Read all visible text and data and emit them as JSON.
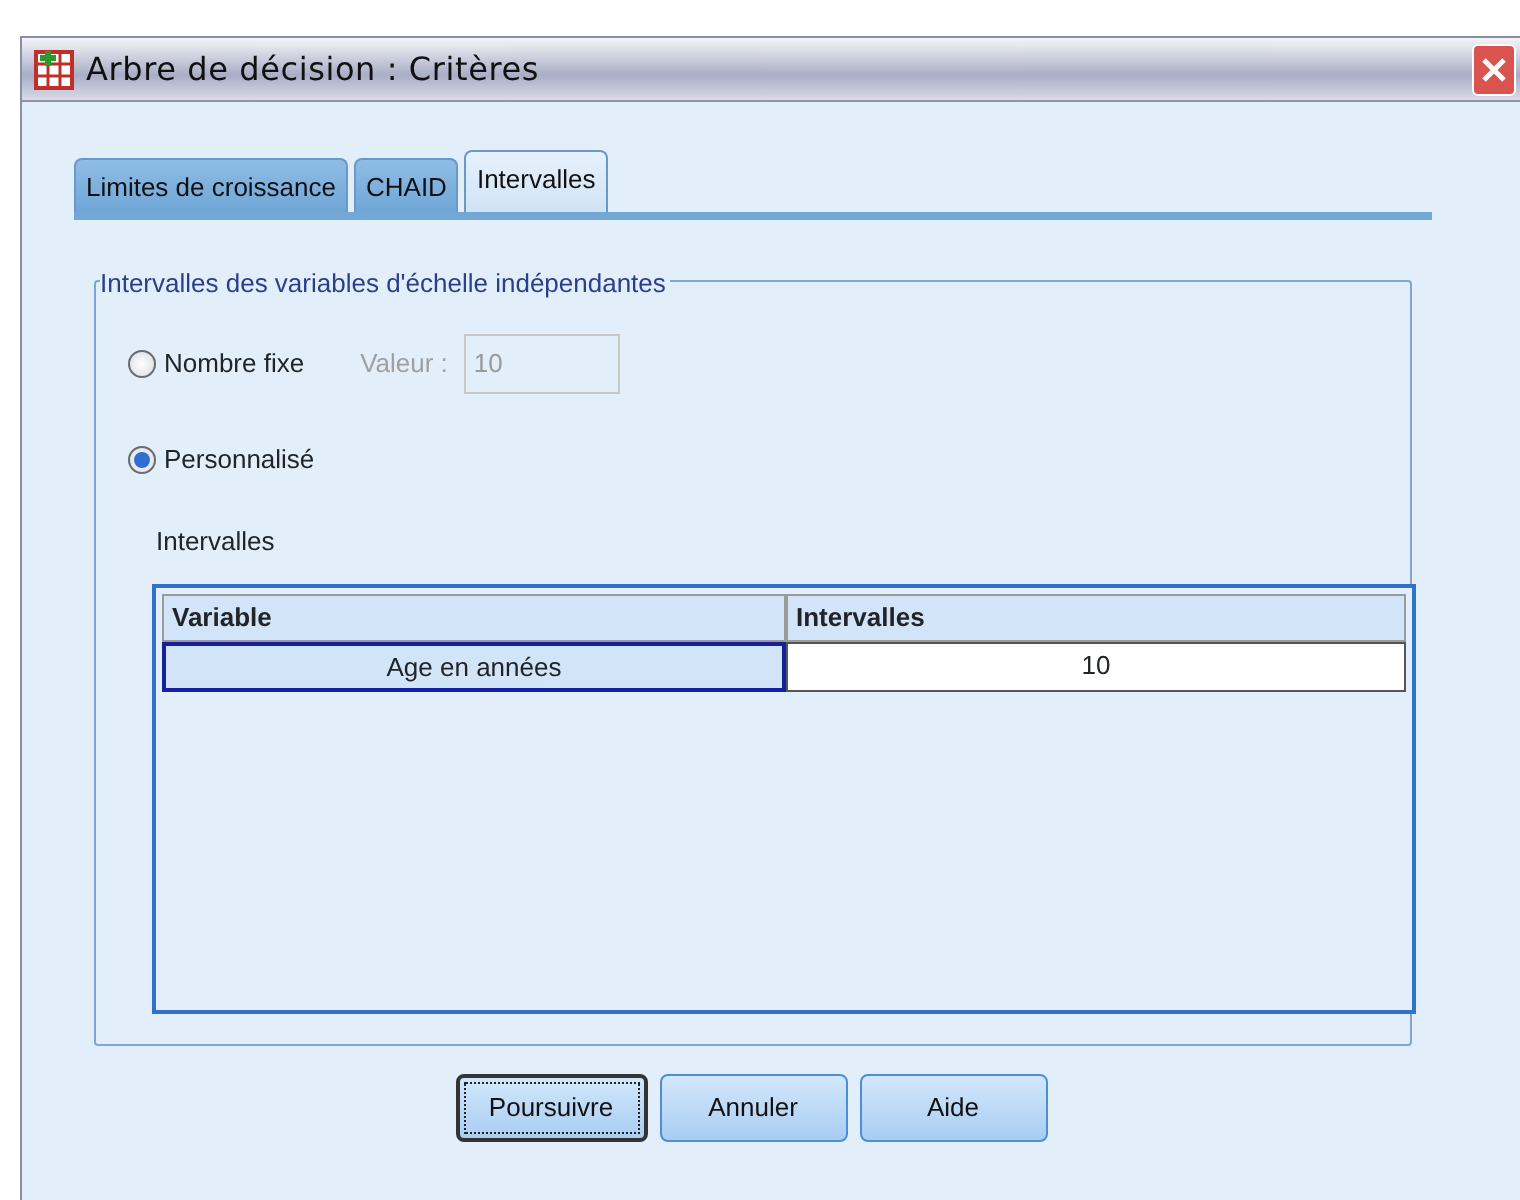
{
  "window": {
    "title": "Arbre de décision : Critères"
  },
  "tabs": [
    {
      "label": "Limites de croissance",
      "selected": false
    },
    {
      "label": "CHAID",
      "selected": false
    },
    {
      "label": "Intervalles",
      "selected": true
    }
  ],
  "group": {
    "title": "Intervalles des variables d'échelle indépendantes",
    "options": [
      {
        "label": "Nombre fixe",
        "selected": false,
        "field": {
          "label": "Valeur :",
          "value": "10",
          "disabled": true
        }
      },
      {
        "label": "Personnalisé",
        "selected": true
      }
    ],
    "list_label": "Intervalles",
    "table": {
      "columns": [
        "Variable",
        "Intervalles"
      ],
      "rows": [
        {
          "cells": [
            "Age en années",
            "10"
          ],
          "selected": true
        }
      ]
    }
  },
  "buttons": [
    {
      "label": "Poursuivre",
      "default": true
    },
    {
      "label": "Annuler",
      "default": false
    },
    {
      "label": "Aide",
      "default": false
    }
  ]
}
